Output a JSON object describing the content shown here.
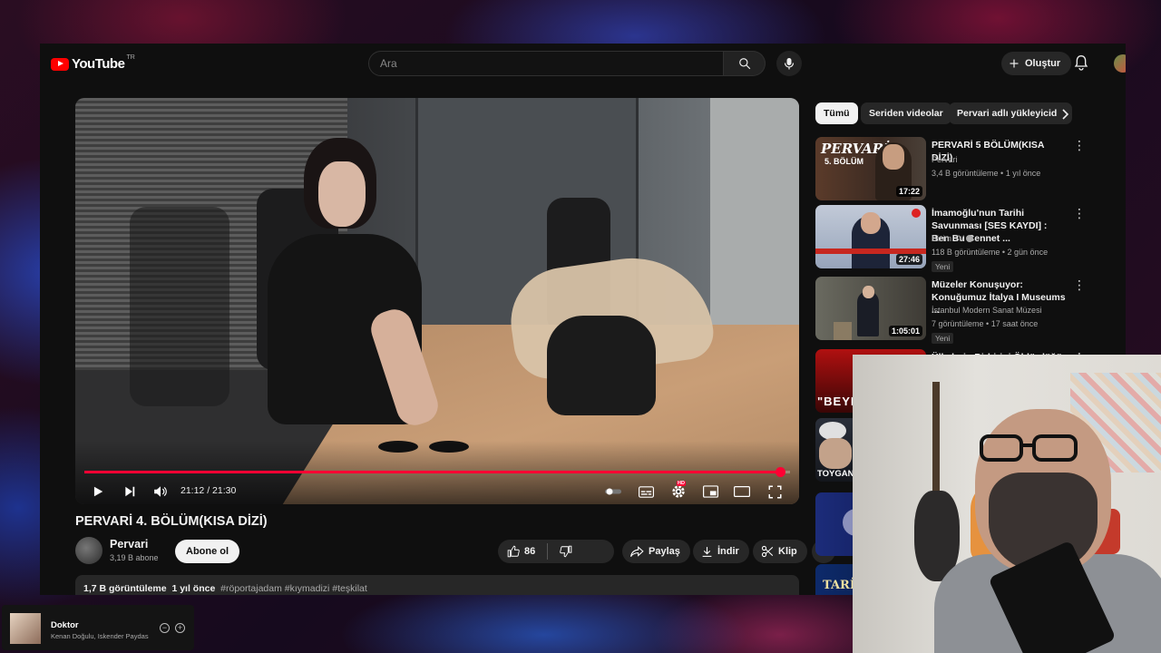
{
  "colors": {
    "accent": "#ff0033",
    "bg": "#0f0f0f",
    "surface": "#272727",
    "muted": "#aaaaaa"
  },
  "header": {
    "logo_text": "YouTube",
    "region": "TR",
    "search_placeholder": "Ara",
    "create_label": "Oluştur",
    "icons": [
      "search-icon",
      "mic-icon",
      "plus-icon",
      "bell-icon",
      "avatar"
    ]
  },
  "player": {
    "time_label": "21:12 / 21:30",
    "progress": 0.986,
    "hd_badge": "HD",
    "icons": [
      "play-icon",
      "next-icon",
      "volume-icon",
      "autoplay-toggle",
      "subtitles-icon",
      "settings-icon",
      "miniplayer-icon",
      "theater-icon",
      "fullscreen-icon"
    ]
  },
  "video": {
    "title": "PERVARİ 4. BÖLÜM(KISA DİZİ)",
    "channel": "Pervari",
    "subscribers": "3,19 B abone",
    "subscribe_label": "Abone ol",
    "likes": "86",
    "share_label": "Paylaş",
    "download_label": "İndir",
    "clip_label": "Klip",
    "views": "1,7 B görüntüleme",
    "age": "1 yıl önce",
    "hashtags": "#röportajadam #kıymadizi #teşkilat"
  },
  "chips": [
    "Tümü",
    "Seriden videolar",
    "Pervari adlı yükleyicid"
  ],
  "recommended": [
    {
      "title": "PERVARİ 5  BÖLÜM(KISA DİZİ)",
      "channel": "Pervari",
      "meta": "3,4 B görüntüleme • 1 yıl önce",
      "duration": "17:22",
      "thumb_text": "PERVARİ",
      "thumb_sub": "5. BÖLÜM",
      "badge": ""
    },
    {
      "title": "İmamoğlu'nun Tarihi Savunması [SES KAYDI] : Ben Bu Cennet ...",
      "channel": "Bizim TV",
      "meta": "118 B görüntüleme • 2 gün önce",
      "duration": "27:46",
      "badge": "Yeni"
    },
    {
      "title": "Müzeler Konuşuyor: Konuğumuz İtalya I Museums ...",
      "channel": "İstanbul Modern Sanat Müzesi",
      "meta": "7 görüntüleme • 17 saat önce",
      "duration": "1:05:01",
      "badge": "Yeni"
    },
    {
      "title": "Ülkelerin Birbirini Öldürdüğü",
      "thumb_text": "\"BEYN"
    },
    {
      "thumb_text": "TOYGAN AV"
    },
    {
      "thumb_text": ""
    },
    {
      "thumb_text": "TARİH"
    }
  ],
  "now_playing": {
    "title": "Doktor",
    "artist": "Kenan Doğulu, Iskender Paydas"
  }
}
